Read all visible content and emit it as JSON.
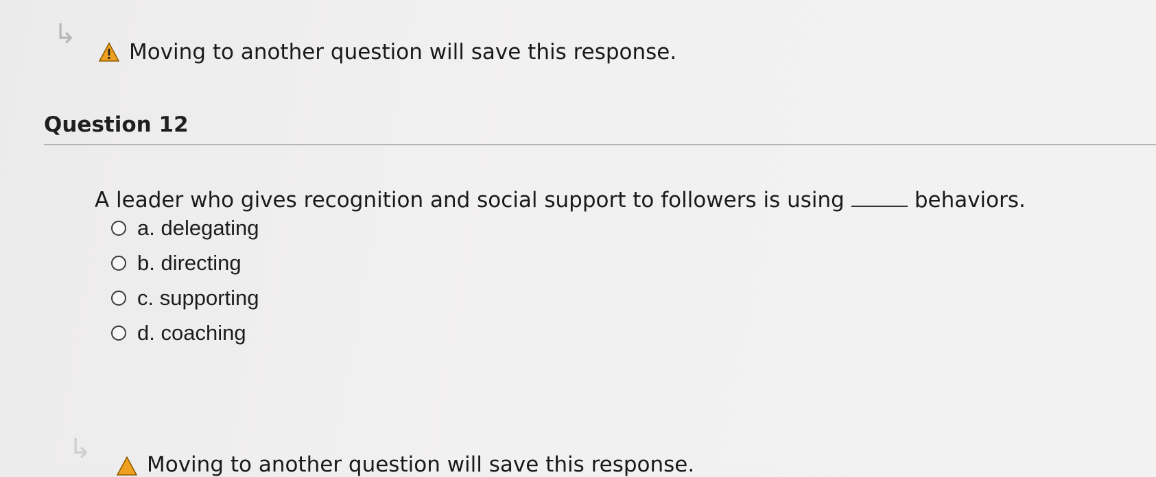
{
  "warning": {
    "message": "Moving to another question will save this response.",
    "icon": "warning-triangle-icon",
    "icon_color": "#f0a020"
  },
  "question": {
    "title": "Question 12",
    "prompt_before": "A leader who gives recognition and social support to followers is using",
    "prompt_after": "behaviors.",
    "options": [
      {
        "label": "a. delegating",
        "selected": false
      },
      {
        "label": "b. directing",
        "selected": false
      },
      {
        "label": "c. supporting",
        "selected": false
      },
      {
        "label": "d. coaching",
        "selected": false
      }
    ]
  },
  "footer_warning": {
    "message": "Moving to another question will save this response."
  }
}
